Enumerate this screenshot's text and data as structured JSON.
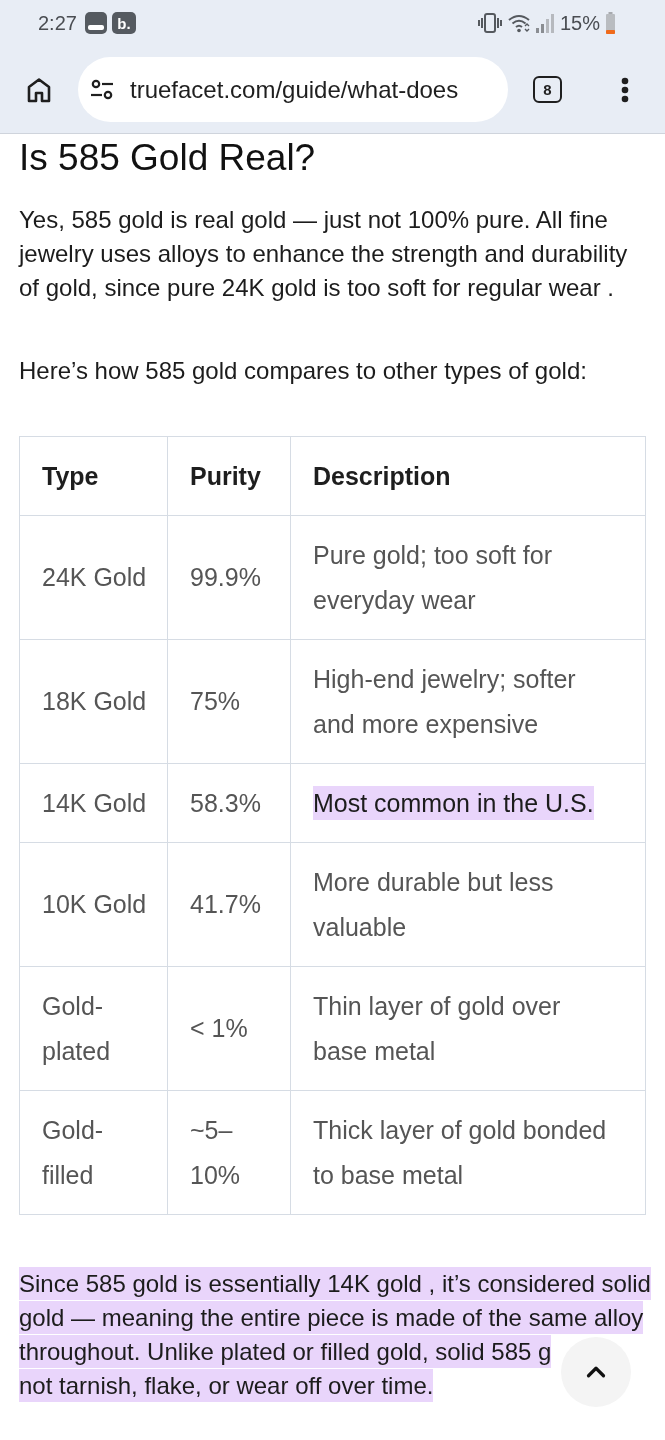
{
  "status_bar": {
    "time": "2:27",
    "notifications": [
      {
        "kind": "tile"
      },
      {
        "kind": "letter",
        "text": "b."
      }
    ],
    "battery_text": "15%"
  },
  "toolbar": {
    "url": "truefacet.com/guide/what-does",
    "tab_count": "8"
  },
  "article": {
    "heading": "Is 585 Gold Real?",
    "paragraphs": [
      {
        "text": "Yes, 585 gold is real gold — just not 100% pure. All fine jewelry uses alloys to enhance the strength and durability of gold, since pure 24K gold is too soft for regular wear .",
        "highlighted": false
      },
      {
        "text": "Here’s how 585 gold compares to other types of gold:",
        "highlighted": false
      }
    ]
  },
  "table": {
    "columns": [
      "Type",
      "Purity",
      "Description"
    ],
    "rows": [
      {
        "type": "24K Gold",
        "purity": "99.9%",
        "description": "Pure gold; too soft for everyday wear",
        "highlighted": false
      },
      {
        "type": "18K Gold",
        "purity": "75%",
        "description": "High-end jewelry; softer and more expensive",
        "highlighted": false
      },
      {
        "type": "14K Gold",
        "purity": "58.3%",
        "description": "Most common in the U.S.",
        "highlighted": true
      },
      {
        "type": "10K Gold",
        "purity": "41.7%",
        "description": "More durable but less valuable",
        "highlighted": false
      },
      {
        "type": "Gold-plated",
        "purity": "< 1%",
        "description": "Thin layer of gold over base metal",
        "highlighted": false
      },
      {
        "type": "Gold-filled",
        "purity": "~5–10%",
        "description": "Thick layer of gold bonded to base metal",
        "highlighted": false
      }
    ]
  },
  "closing_paragraph": {
    "parts": [
      "Since 585 gold is essentially 14K gold , it’s considered solid gold — meaning the entire piece is made of the same alloy throughout. Unlike plated or filled gold, solid 585 g",
      "not tarnish, flake, or wear off over time."
    ],
    "highlighted": true
  }
}
